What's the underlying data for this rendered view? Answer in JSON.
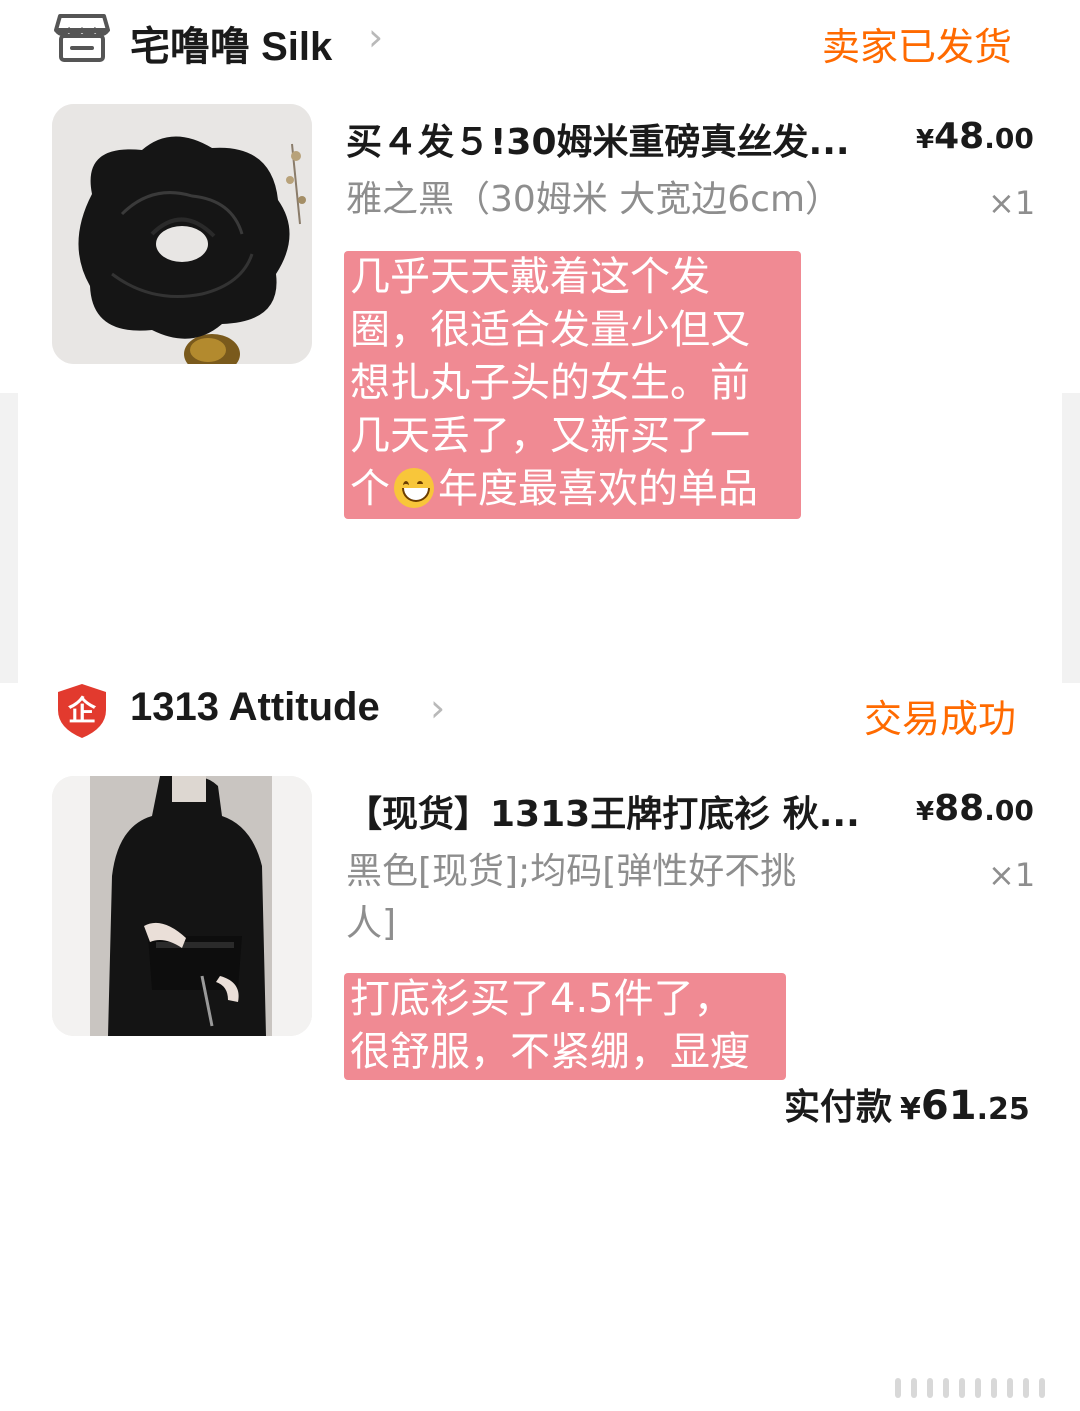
{
  "orders": [
    {
      "store": {
        "name": "宅噜噜 Silk",
        "icon": "store-icon"
      },
      "status": "卖家已发货",
      "item": {
        "title": "买４发５!30姆米重磅真丝发...",
        "price_symbol": "¥",
        "price_int": "48",
        "price_dec": ".00",
        "sku": "雅之黑（30姆米 大宽边6cm）",
        "qty": "×1"
      },
      "note_lines": [
        "几乎天天戴着这个发",
        "圈，很适合发量少但又",
        "想扎丸子头的女生。前",
        "几天丢了，又新买了一"
      ],
      "note_last_pre": "个",
      "note_last_post": "年度最喜欢的单品",
      "note_emoji": "grinning-face-emoji"
    },
    {
      "store": {
        "name": "1313 Attitude",
        "icon": "enterprise-shield-icon",
        "icon_glyph": "企"
      },
      "status": "交易成功",
      "item": {
        "title": "【现货】1313王牌打底衫 秋...",
        "price_symbol": "¥",
        "price_int": "88",
        "price_dec": ".00",
        "sku_lines": [
          "黑色[现货];均码[弹性好不挑",
          "人]"
        ],
        "qty": "×1"
      },
      "note_lines": [
        "打底衫买了4.5件了，",
        "很舒服，不紧绷，显瘦"
      ],
      "paid": {
        "label": "实付款",
        "symbol": "¥",
        "int": "61",
        "dec": ".25"
      }
    }
  ],
  "colors": {
    "accent": "#ff6a00",
    "note_bg": "#f08a93",
    "shield_red": "#e23a2e"
  }
}
